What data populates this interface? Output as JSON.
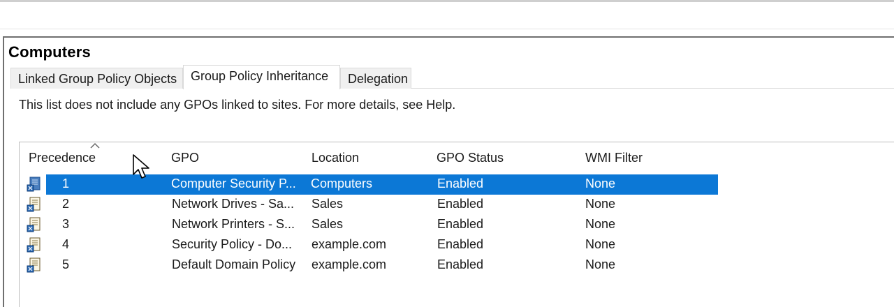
{
  "panel": {
    "title": "Computers",
    "tabs": [
      {
        "label": "Linked Group Policy Objects",
        "active": false
      },
      {
        "label": "Group Policy Inheritance",
        "active": true
      },
      {
        "label": "Delegation",
        "active": false
      }
    ],
    "notice": "This list does not include any GPOs linked to sites. For more details, see Help."
  },
  "table": {
    "columns": [
      "Precedence",
      "GPO",
      "Location",
      "GPO Status",
      "WMI Filter"
    ],
    "sort_indicator": "^",
    "rows": [
      {
        "precedence": "1",
        "gpo": "Computer Security P...",
        "location": "Computers",
        "status": "Enabled",
        "wmi": "None",
        "selected": true
      },
      {
        "precedence": "2",
        "gpo": "Network Drives - Sa...",
        "location": "Sales",
        "status": "Enabled",
        "wmi": "None",
        "selected": false
      },
      {
        "precedence": "3",
        "gpo": "Network Printers - S...",
        "location": "Sales",
        "status": "Enabled",
        "wmi": "None",
        "selected": false
      },
      {
        "precedence": "4",
        "gpo": "Security Policy - Do...",
        "location": "example.com",
        "status": "Enabled",
        "wmi": "None",
        "selected": false
      },
      {
        "precedence": "5",
        "gpo": "Default Domain Policy",
        "location": "example.com",
        "status": "Enabled",
        "wmi": "None",
        "selected": false
      }
    ]
  },
  "colors": {
    "selection": "#0c78d6",
    "tab_inactive": "#f0f0f0",
    "border": "#6f6f6f"
  },
  "icons": {
    "row_icon": "gpo-scroll-icon",
    "pointer": "mouse-cursor-icon"
  }
}
